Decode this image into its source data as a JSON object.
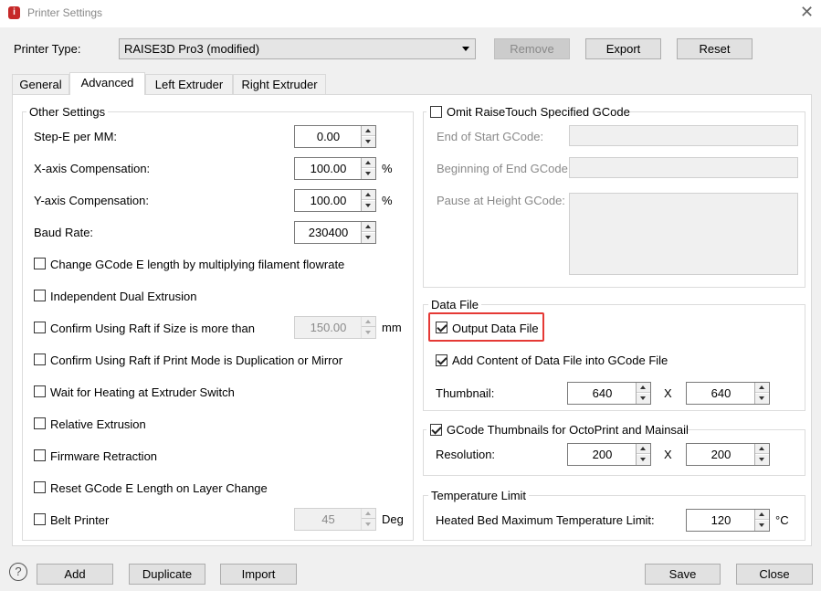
{
  "window": {
    "title": "Printer Settings",
    "app_icon_glyph": "i",
    "close_glyph": "✕"
  },
  "top": {
    "printer_type_label": "Printer Type:",
    "printer_type_value": "RAISE3D Pro3 (modified)",
    "remove_label": "Remove",
    "export_label": "Export",
    "reset_label": "Reset"
  },
  "tabs": [
    {
      "label": "General",
      "active": false
    },
    {
      "label": "Advanced",
      "active": true
    },
    {
      "label": "Left Extruder",
      "active": false
    },
    {
      "label": "Right Extruder",
      "active": false
    }
  ],
  "other_settings": {
    "title": "Other Settings",
    "step_e_label": "Step-E per MM:",
    "step_e_value": "0.00",
    "x_comp_label": "X-axis Compensation:",
    "x_comp_value": "100.00",
    "x_comp_unit": "%",
    "y_comp_label": "Y-axis Compensation:",
    "y_comp_value": "100.00",
    "y_comp_unit": "%",
    "baud_label": "Baud Rate:",
    "baud_value": "230400",
    "checkboxes": {
      "change_gcode": "Change GCode E length by multiplying filament flowrate",
      "independent_dual": "Independent Dual Extrusion",
      "confirm_raft_size": "Confirm Using Raft if Size is more than",
      "confirm_raft_mode": "Confirm Using Raft if Print Mode is Duplication or Mirror",
      "wait_heating": "Wait for Heating at Extruder Switch",
      "relative_extrusion": "Relative Extrusion",
      "firmware_retraction": "Firmware Retraction",
      "reset_gcode_e": "Reset GCode E Length on Layer Change",
      "belt_printer": "Belt Printer"
    },
    "raft_size_value": "150.00",
    "raft_size_unit": "mm",
    "belt_value": "45",
    "belt_unit": "Deg"
  },
  "omit_gcode": {
    "title": "Omit RaiseTouch Specified GCode",
    "checked": false,
    "end_of_start_label": "End of Start GCode:",
    "beginning_of_end_label": "Beginning of End GCode:",
    "pause_label": "Pause at Height GCode:"
  },
  "data_file": {
    "title": "Data File",
    "output_label": "Output Data File",
    "output_checked": true,
    "add_content_label": "Add Content of Data File into GCode File",
    "add_content_checked": true,
    "thumbnail_label": "Thumbnail:",
    "thumb_w": "640",
    "thumb_h": "640",
    "x_sep": "X"
  },
  "octoprint": {
    "title": "GCode Thumbnails for OctoPrint and Mainsail",
    "checked": true,
    "resolution_label": "Resolution:",
    "res_w": "200",
    "res_h": "200",
    "x_sep": "X"
  },
  "temperature": {
    "title": "Temperature Limit",
    "bed_label": "Heated Bed Maximum Temperature Limit:",
    "bed_value": "120",
    "bed_unit": "°C"
  },
  "bottom": {
    "help_glyph": "?",
    "add_label": "Add",
    "duplicate_label": "Duplicate",
    "import_label": "Import",
    "save_label": "Save",
    "close_label": "Close"
  },
  "colors": {
    "highlight": "#e53935",
    "title_red": "#c62828"
  }
}
